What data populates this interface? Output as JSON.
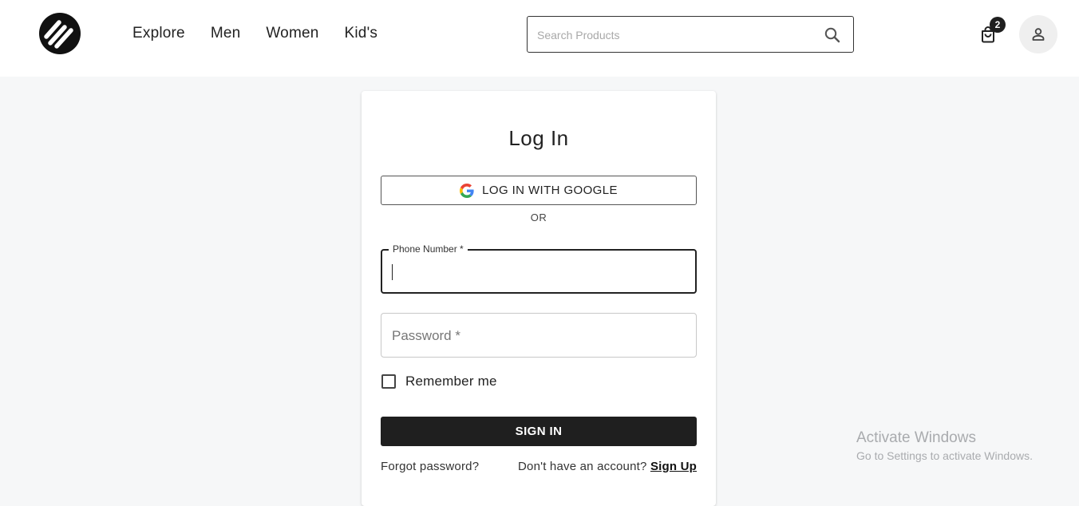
{
  "header": {
    "nav": [
      {
        "label": "Explore"
      },
      {
        "label": "Men"
      },
      {
        "label": "Women"
      },
      {
        "label": "Kid's"
      }
    ],
    "search": {
      "placeholder": "Search Products",
      "value": ""
    },
    "cart": {
      "count": "2"
    },
    "icons": {
      "logo": "brand-logo-icon",
      "search": "search-icon",
      "cart": "shopping-bag-icon",
      "profile": "user-icon"
    }
  },
  "login": {
    "title": "Log In",
    "google_label": "LOG IN WITH GOOGLE",
    "or_label": "OR",
    "phone_label": "Phone Number *",
    "phone_value": "",
    "password_label": "Password *",
    "remember_label": "Remember me",
    "remember_checked": false,
    "signin_label": "SIGN IN",
    "forgot_label": "Forgot password?",
    "no_account_label": "Don't have an account?",
    "signup_label": "Sign Up"
  },
  "watermark": {
    "title": "Activate Windows",
    "subtitle": "Go to Settings to activate Windows."
  },
  "colors": {
    "page_bg": "#f6f7f8",
    "primary_button": "#1f1f1f",
    "badge_bg": "#1f1f1f",
    "google_blue": "#4285F4",
    "google_red": "#EA4335",
    "google_yellow": "#FBBC05",
    "google_green": "#34A853"
  }
}
